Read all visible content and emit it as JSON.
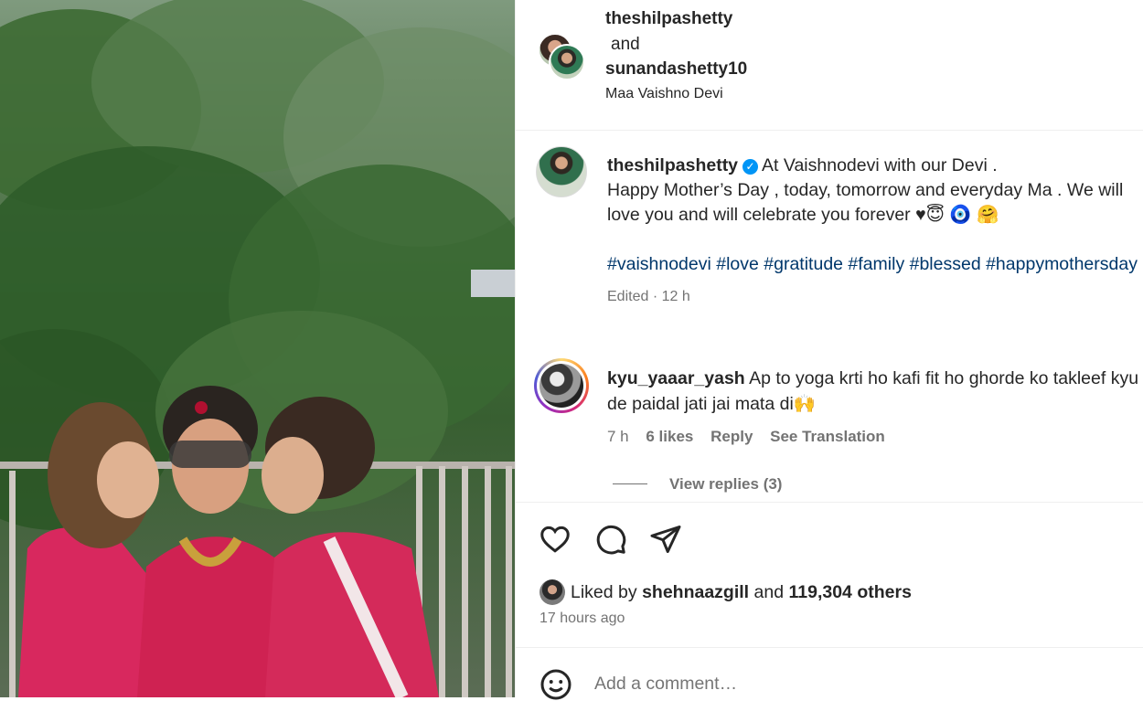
{
  "post_image": {
    "alt_icon": "photo"
  },
  "header": {
    "user1": "theshilpashetty",
    "conjunction": "and",
    "user2": "sunandashetty10",
    "location": "Maa Vaishno Devi"
  },
  "caption": {
    "username": "theshilpashetty",
    "verified_icon": "verified-badge-icon",
    "line1": "At Vaishnodevi with our Devi .",
    "line2": "Happy Mother’s Day , today, tomorrow and everyday Ma . We will love you and will celebrate you forever ♥😇 🧿 🤗",
    "hashtags": "#vaishnodevi #love #gratitude #family #blessed #happymothersday",
    "meta": "Edited · 12 h"
  },
  "comment": {
    "username": "kyu_yaaar_yash",
    "text": "Ap to yoga krti ho kafi fit ho ghorde ko takleef kyu de paidal jati jai mata di🙌",
    "time": "7 h",
    "likes": "6 likes",
    "reply": "Reply",
    "see_translation": "See Translation",
    "view_replies": "View replies (3)"
  },
  "actions": {
    "icons": [
      "heart-icon",
      "comment-icon",
      "share-icon"
    ],
    "liked_by_prefix": "Liked by",
    "liked_by_user": "shehnaazgill",
    "liked_by_and": "and",
    "liked_by_others": "119,304 others",
    "posted": "17 hours ago"
  },
  "add_comment": {
    "placeholder": "Add a comment…",
    "emoji_icon": "smiley-icon"
  }
}
